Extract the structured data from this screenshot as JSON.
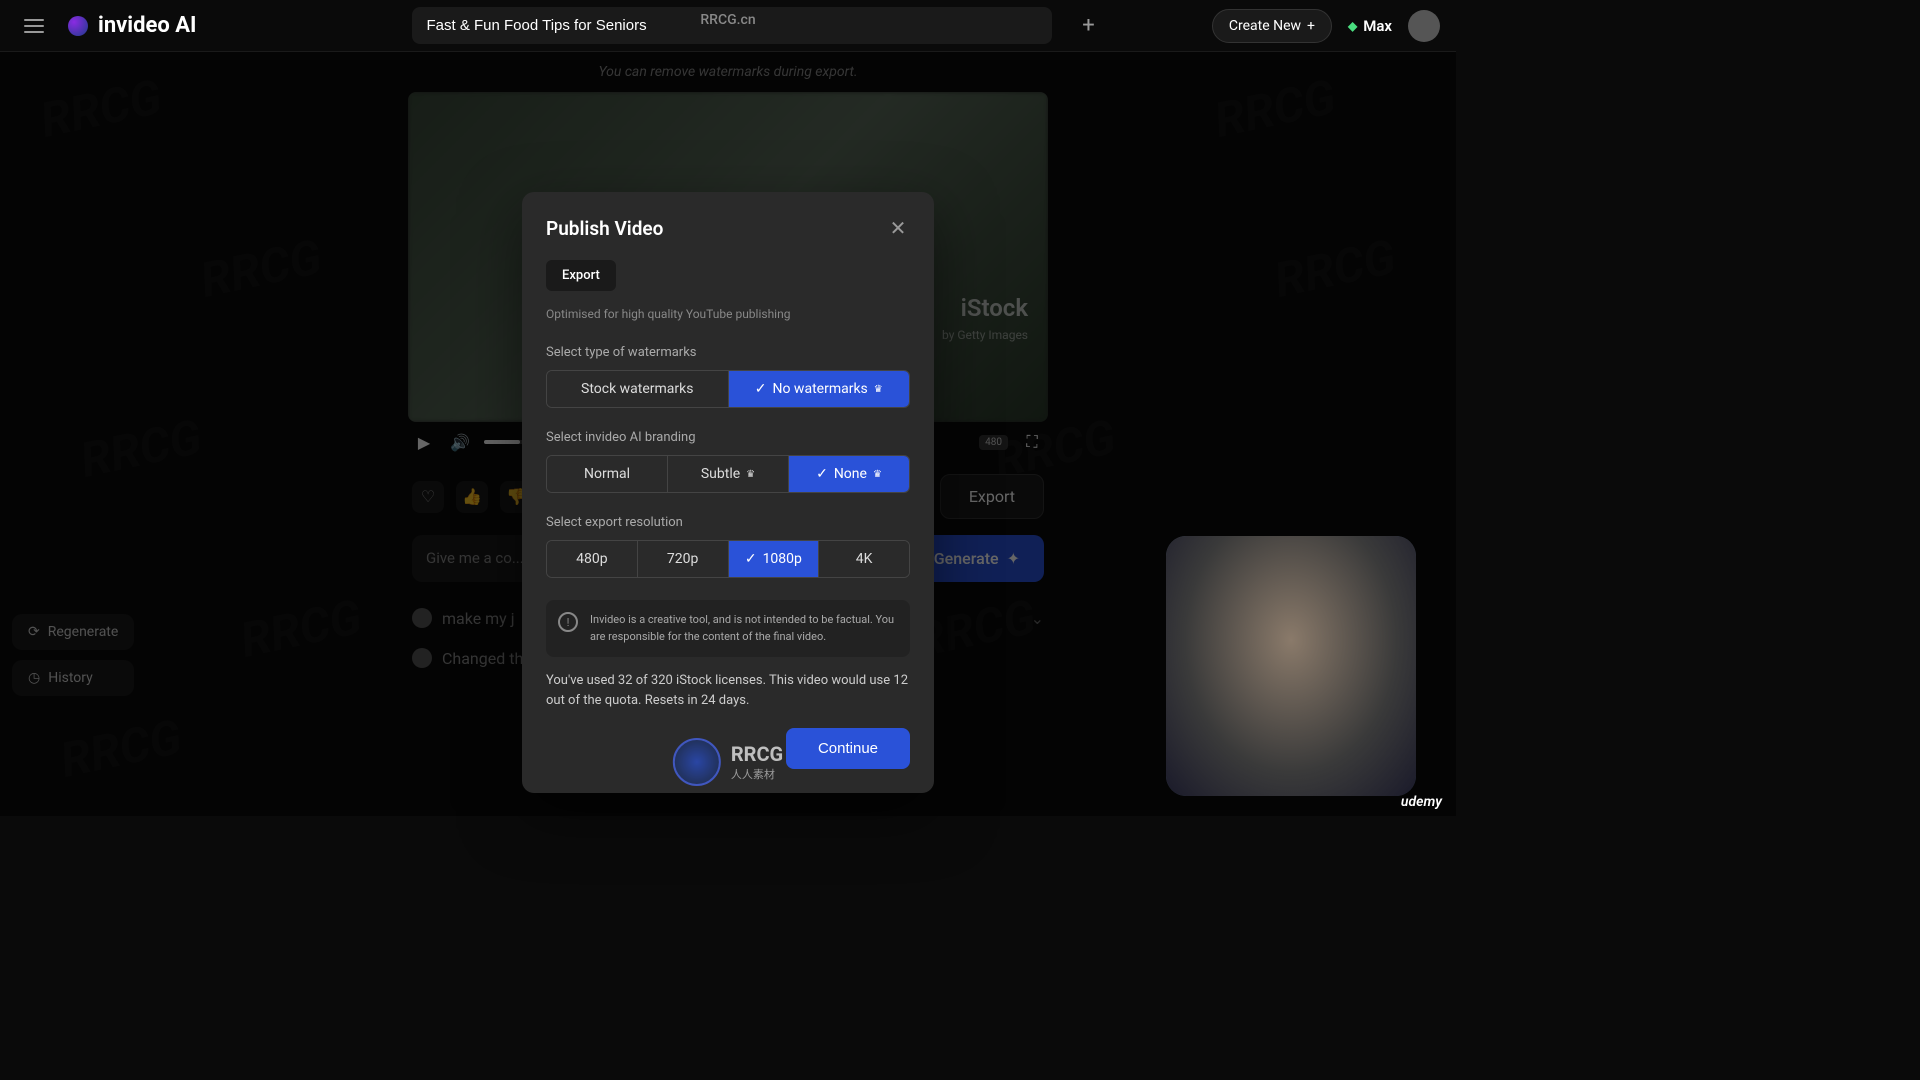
{
  "header": {
    "brand": "invideo AI",
    "title_value": "Fast & Fun Food Tips for Seniors",
    "top_url": "RRCG.cn",
    "create_new": "Create New",
    "plan": "Max"
  },
  "video": {
    "watermark_hint": "You can remove watermarks during export.",
    "istock": "iStock",
    "istock_sub": "by Getty Images",
    "res_badge": "480"
  },
  "actions": {
    "export": "Export",
    "generate": "Generate",
    "prompt_placeholder": "Give me a co..."
  },
  "history": {
    "item1": "make my j",
    "item2": "Changed the"
  },
  "side": {
    "regenerate": "Regenerate",
    "history": "History"
  },
  "modal": {
    "title": "Publish Video",
    "tab": "Export",
    "tab_hint": "Optimised for high quality YouTube publishing",
    "watermark_label": "Select type of watermarks",
    "watermark_options": {
      "stock": "Stock watermarks",
      "none": "No watermarks"
    },
    "branding_label": "Select invideo AI branding",
    "branding_options": {
      "normal": "Normal",
      "subtle": "Subtle",
      "none": "None"
    },
    "resolution_label": "Select export resolution",
    "resolution_options": {
      "r480": "480p",
      "r720": "720p",
      "r1080": "1080p",
      "r4k": "4K"
    },
    "info_text": "Invideo is a creative tool, and is not intended to be factual. You are responsible for the content of the final video.",
    "quota_text": "You've used 32 of 320 iStock licenses. This video would use 12 out of the quota. Resets in 24 days.",
    "continue": "Continue"
  },
  "bottom": {
    "logo_text": "RRCG",
    "logo_sub": "人人素材"
  },
  "udemy": "udemy",
  "bg_watermark": "RRCG"
}
